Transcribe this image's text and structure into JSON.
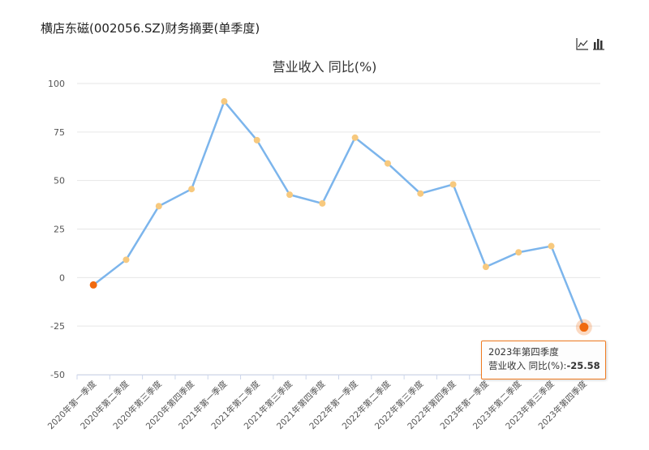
{
  "page": {
    "title": "横店东磁(002056.SZ)财务摘要(单季度)"
  },
  "toolbar": {
    "line_icon": "line-chart-icon",
    "bar_icon": "bar-chart-icon"
  },
  "tooltip": {
    "category": "2023年第四季度",
    "label": "营业收入 同比(%):",
    "value": "-25.58"
  },
  "colors": {
    "line": "#7cb5ec",
    "marker": "#f7c97e",
    "highlight": "#f06a0f",
    "grid": "#e6e6e6",
    "tooltip_border": "#f07b20"
  },
  "chart_data": {
    "type": "line",
    "title": "营业收入 同比(%)",
    "xlabel": "",
    "ylabel": "",
    "ylim": [
      -50,
      100
    ],
    "yticks": [
      -50,
      -25,
      0,
      25,
      50,
      75,
      100
    ],
    "grid": true,
    "legend": "none",
    "categories": [
      "2020年第一季度",
      "2020年第二季度",
      "2020年第三季度",
      "2020年第四季度",
      "2021年第一季度",
      "2021年第二季度",
      "2021年第三季度",
      "2021年第四季度",
      "2022年第一季度",
      "2022年第二季度",
      "2022年第三季度",
      "2022年第四季度",
      "2023年第一季度",
      "2023年第二季度",
      "2023年第三季度",
      "2023年第四季度"
    ],
    "series": [
      {
        "values": [
          -3.8,
          9.2,
          36.8,
          45.6,
          90.8,
          70.8,
          42.7,
          38.2,
          72.1,
          58.8,
          43.3,
          48.0,
          5.5,
          13.0,
          16.2,
          -25.58
        ]
      }
    ],
    "highlighted_points": [
      0,
      15
    ]
  }
}
